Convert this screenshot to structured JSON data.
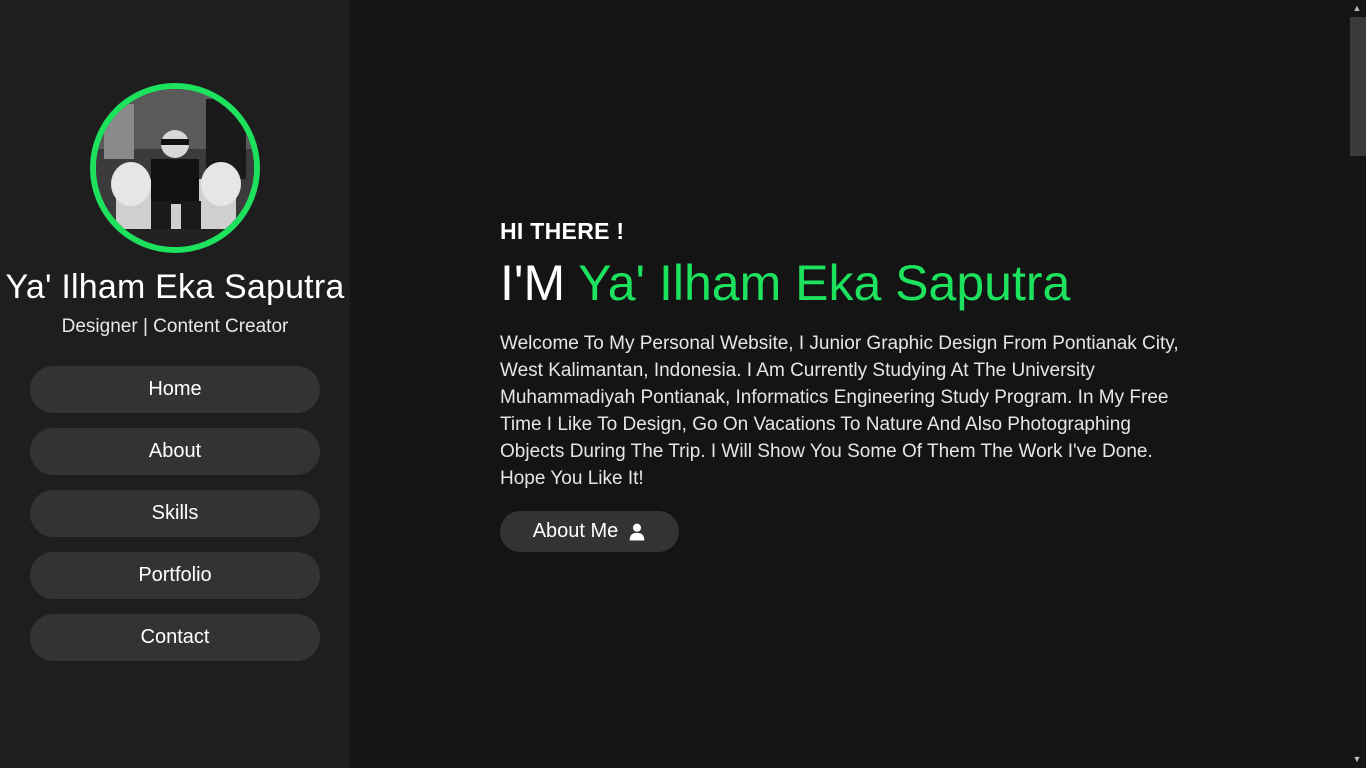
{
  "sidebar": {
    "profile_name": "Ya' Ilham Eka Saputra",
    "profile_role": "Designer | Content Creator",
    "nav": [
      {
        "label": "Home"
      },
      {
        "label": "About"
      },
      {
        "label": "Skills"
      },
      {
        "label": "Portfolio"
      },
      {
        "label": "Contact"
      }
    ]
  },
  "main": {
    "greeting": "HI THERE !",
    "headline_prefix": "I'M",
    "headline_name": "Ya' Ilham Eka Saputra",
    "intro": "Welcome To My Personal Website, I Junior Graphic Design From Pontianak City, West Kalimantan, Indonesia. I Am Currently Studying At The University Muhammadiyah Pontianak, Informatics Engineering Study Program. In My Free Time I Like To Design, Go On Vacations To Nature And Also Photographing Objects During The Trip. I Will Show You Some Of Them The Work I've Done. Hope You Like It!",
    "about_button_label": "About Me",
    "about_button_icon": "user-icon"
  },
  "colors": {
    "accent": "#1de25d",
    "sidebar_bg": "#1e1e1e",
    "main_bg": "#141414",
    "button_bg": "#333333"
  }
}
